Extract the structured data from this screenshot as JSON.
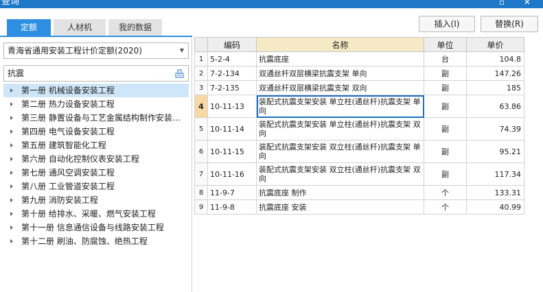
{
  "window": {
    "title": "查询",
    "controls": "▫ ✕"
  },
  "tabs": [
    {
      "label": "定额"
    },
    {
      "label": "人材机"
    },
    {
      "label": "我的数据"
    }
  ],
  "buttons": {
    "insert": "插入(I)",
    "replace": "替换(R)"
  },
  "quota_select": {
    "value": "青海省通用安装工程计价定额(2020)"
  },
  "search": {
    "value": "抗震"
  },
  "tree": [
    {
      "label": "第一册 机械设备安装工程"
    },
    {
      "label": "第二册 热力设备安装工程"
    },
    {
      "label": "第三册 静置设备与工艺金属结构制作安装…"
    },
    {
      "label": "第四册 电气设备安装工程"
    },
    {
      "label": "第五册 建筑智能化工程"
    },
    {
      "label": "第六册 自动化控制仪表安装工程"
    },
    {
      "label": "第七册 通风空调安装工程"
    },
    {
      "label": "第八册 工业管道安装工程"
    },
    {
      "label": "第九册 消防安装工程"
    },
    {
      "label": "第十册 给排水、采暖、燃气安装工程"
    },
    {
      "label": "第十一册 信息通信设备与线路安装工程"
    },
    {
      "label": "第十二册 刷油、防腐蚀、绝热工程"
    }
  ],
  "table": {
    "columns": [
      "",
      "编码",
      "名称",
      "单位",
      "单价"
    ],
    "rows": [
      {
        "idx": "1",
        "code": "5-2-4",
        "name": "抗震底座",
        "unit": "台",
        "price": "104.8"
      },
      {
        "idx": "2",
        "code": "7-2-134",
        "name": "双通丝杆双层横梁抗震支架 单向",
        "unit": "副",
        "price": "147.26"
      },
      {
        "idx": "3",
        "code": "7-2-135",
        "name": "双通丝杆双层横梁抗震支架 双向",
        "unit": "副",
        "price": "185"
      },
      {
        "idx": "4",
        "code": "10-11-13",
        "name": "装配式抗震支架安装 单立柱(通丝杆)抗震支架 单向",
        "unit": "副",
        "price": "63.86"
      },
      {
        "idx": "5",
        "code": "10-11-14",
        "name": "装配式抗震支架安装 单立柱(通丝杆)抗震支架 双向",
        "unit": "副",
        "price": "74.39"
      },
      {
        "idx": "6",
        "code": "10-11-15",
        "name": "装配式抗震支架安装 双立柱(通丝杆)抗震支架 单向",
        "unit": "副",
        "price": "95.21"
      },
      {
        "idx": "7",
        "code": "10-11-16",
        "name": "装配式抗震支架安装 双立柱(通丝杆)抗震支架 双向",
        "unit": "副",
        "price": "117.34"
      },
      {
        "idx": "8",
        "code": "11-9-7",
        "name": "抗震底座 制作",
        "unit": "个",
        "price": "133.31"
      },
      {
        "idx": "9",
        "code": "11-9-8",
        "name": "抗震底座 安装",
        "unit": "个",
        "price": "40.99"
      }
    ]
  },
  "colors": {
    "accent": "#2e8fe0",
    "titlebar": "#1f78c8",
    "selected_row_header": "#f7d9a5",
    "tree_selected": "#cfe6f9"
  }
}
